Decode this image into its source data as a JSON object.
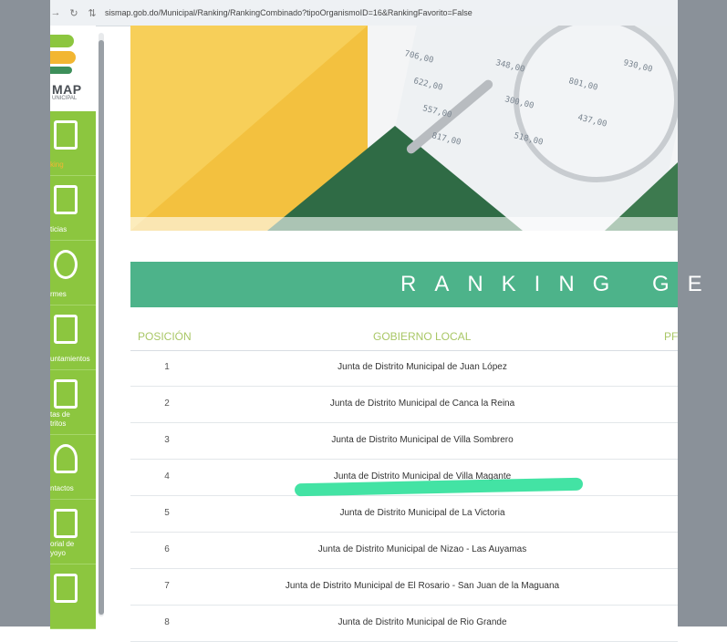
{
  "browser": {
    "back_icon": "back-arrow-icon",
    "reload_icon": "reload-icon",
    "site_icon": "site-settings-icon",
    "url": "sismap.gob.do/Municipal/Ranking/RankingCombinado?tipoOrganismoID=16&RankingFavorito=False"
  },
  "logo": {
    "text": "MAP",
    "subtext": "UNICIPAL"
  },
  "sidebar": {
    "items": [
      {
        "label": "king",
        "icon": "document-check-icon"
      },
      {
        "label": "ticias",
        "icon": "newspaper-icon"
      },
      {
        "label": "rmes",
        "icon": "chart-nodes-icon"
      },
      {
        "label": "untamientos",
        "icon": "city-hall-icon"
      },
      {
        "label": "tas de\ntritos",
        "icon": "people-network-icon"
      },
      {
        "label": "ntactos",
        "icon": "person-icon"
      },
      {
        "label": "orial de\nyoyo",
        "icon": "tablet-icon"
      },
      {
        "label": "",
        "icon": "table-icon"
      }
    ]
  },
  "banner": {
    "title": "RANKING GE"
  },
  "table": {
    "headers": {
      "position": "POSICIÓN",
      "gov": "GOBIERNO LOCAL",
      "partial": "PF"
    },
    "rows": [
      {
        "pos": "1",
        "name": "Junta de Distrito Municipal de Juan López"
      },
      {
        "pos": "2",
        "name": "Junta de Distrito Municipal de Canca la Reina"
      },
      {
        "pos": "3",
        "name": "Junta de Distrito Municipal de Villa Sombrero"
      },
      {
        "pos": "4",
        "name": "Junta de Distrito Municipal de Villa Magante"
      },
      {
        "pos": "5",
        "name": "Junta de Distrito Municipal de La Victoria"
      },
      {
        "pos": "6",
        "name": "Junta de Distrito Municipal de Nizao - Las Auyamas"
      },
      {
        "pos": "7",
        "name": "Junta de Distrito Municipal de El Rosario - San Juan de la Maguana"
      },
      {
        "pos": "8",
        "name": "Junta de Distrito Municipal de Rio Grande"
      }
    ]
  },
  "colors": {
    "sidebar_green": "#8cc63f",
    "banner_green": "#4db38a",
    "highlight": "#2fe09a",
    "header_text": "#a9c766"
  }
}
